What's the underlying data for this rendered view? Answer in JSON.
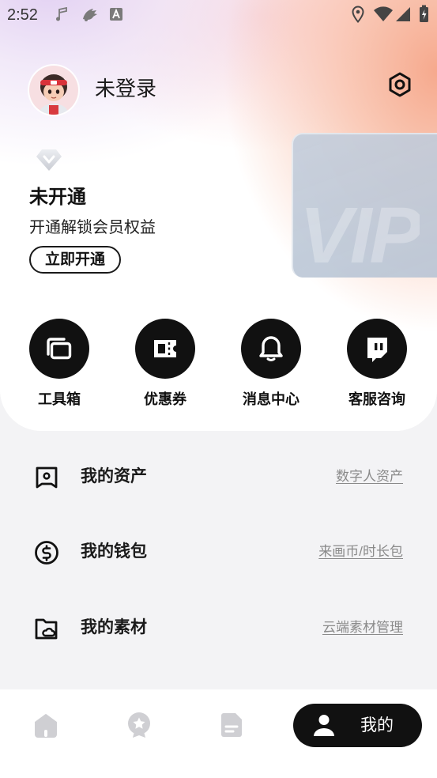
{
  "status_bar": {
    "time": "2:52",
    "left_icons": [
      "music-note-icon",
      "app-notification-icon",
      "a-box-icon"
    ],
    "right_icons": [
      "location-icon",
      "wifi-icon",
      "signal-icon",
      "battery-charging-icon"
    ]
  },
  "profile": {
    "name": "未登录",
    "avatar_icon": "cartoon-avatar",
    "settings_icon": "settings-hexagon-icon"
  },
  "vip": {
    "badge_icon": "diamond-icon",
    "status": "未开通",
    "description": "开通解锁会员权益",
    "button_label": "立即开通",
    "card_text": "VIP"
  },
  "shortcuts": [
    {
      "label": "工具箱",
      "icon": "toolbox-icon"
    },
    {
      "label": "优惠券",
      "icon": "coupon-icon"
    },
    {
      "label": "消息中心",
      "icon": "bell-icon"
    },
    {
      "label": "客服咨询",
      "icon": "chat-bubble-icon"
    }
  ],
  "menu": [
    {
      "title": "我的资产",
      "link": "数字人资产",
      "icon": "asset-frame-icon"
    },
    {
      "title": "我的钱包",
      "link": "来画币/时长包",
      "icon": "dollar-coin-icon"
    },
    {
      "title": "我的素材",
      "link": "云端素材管理",
      "icon": "cloud-folder-icon"
    }
  ],
  "bottom_nav": {
    "items": [
      {
        "icon": "home-icon",
        "active": false
      },
      {
        "icon": "star-badge-icon",
        "active": false
      },
      {
        "icon": "document-icon",
        "active": false
      },
      {
        "icon": "person-icon",
        "active": true,
        "label": "我的"
      }
    ]
  },
  "colors": {
    "primary": "#111111",
    "link_text": "#8a8a8a",
    "page_background": "#f3f3f5",
    "inactive_nav_icon": "#cfcfd3",
    "vip_card": "#c4cedc",
    "gradient_peach": "#f6a98d",
    "gradient_lavender": "#e2d0f2"
  }
}
